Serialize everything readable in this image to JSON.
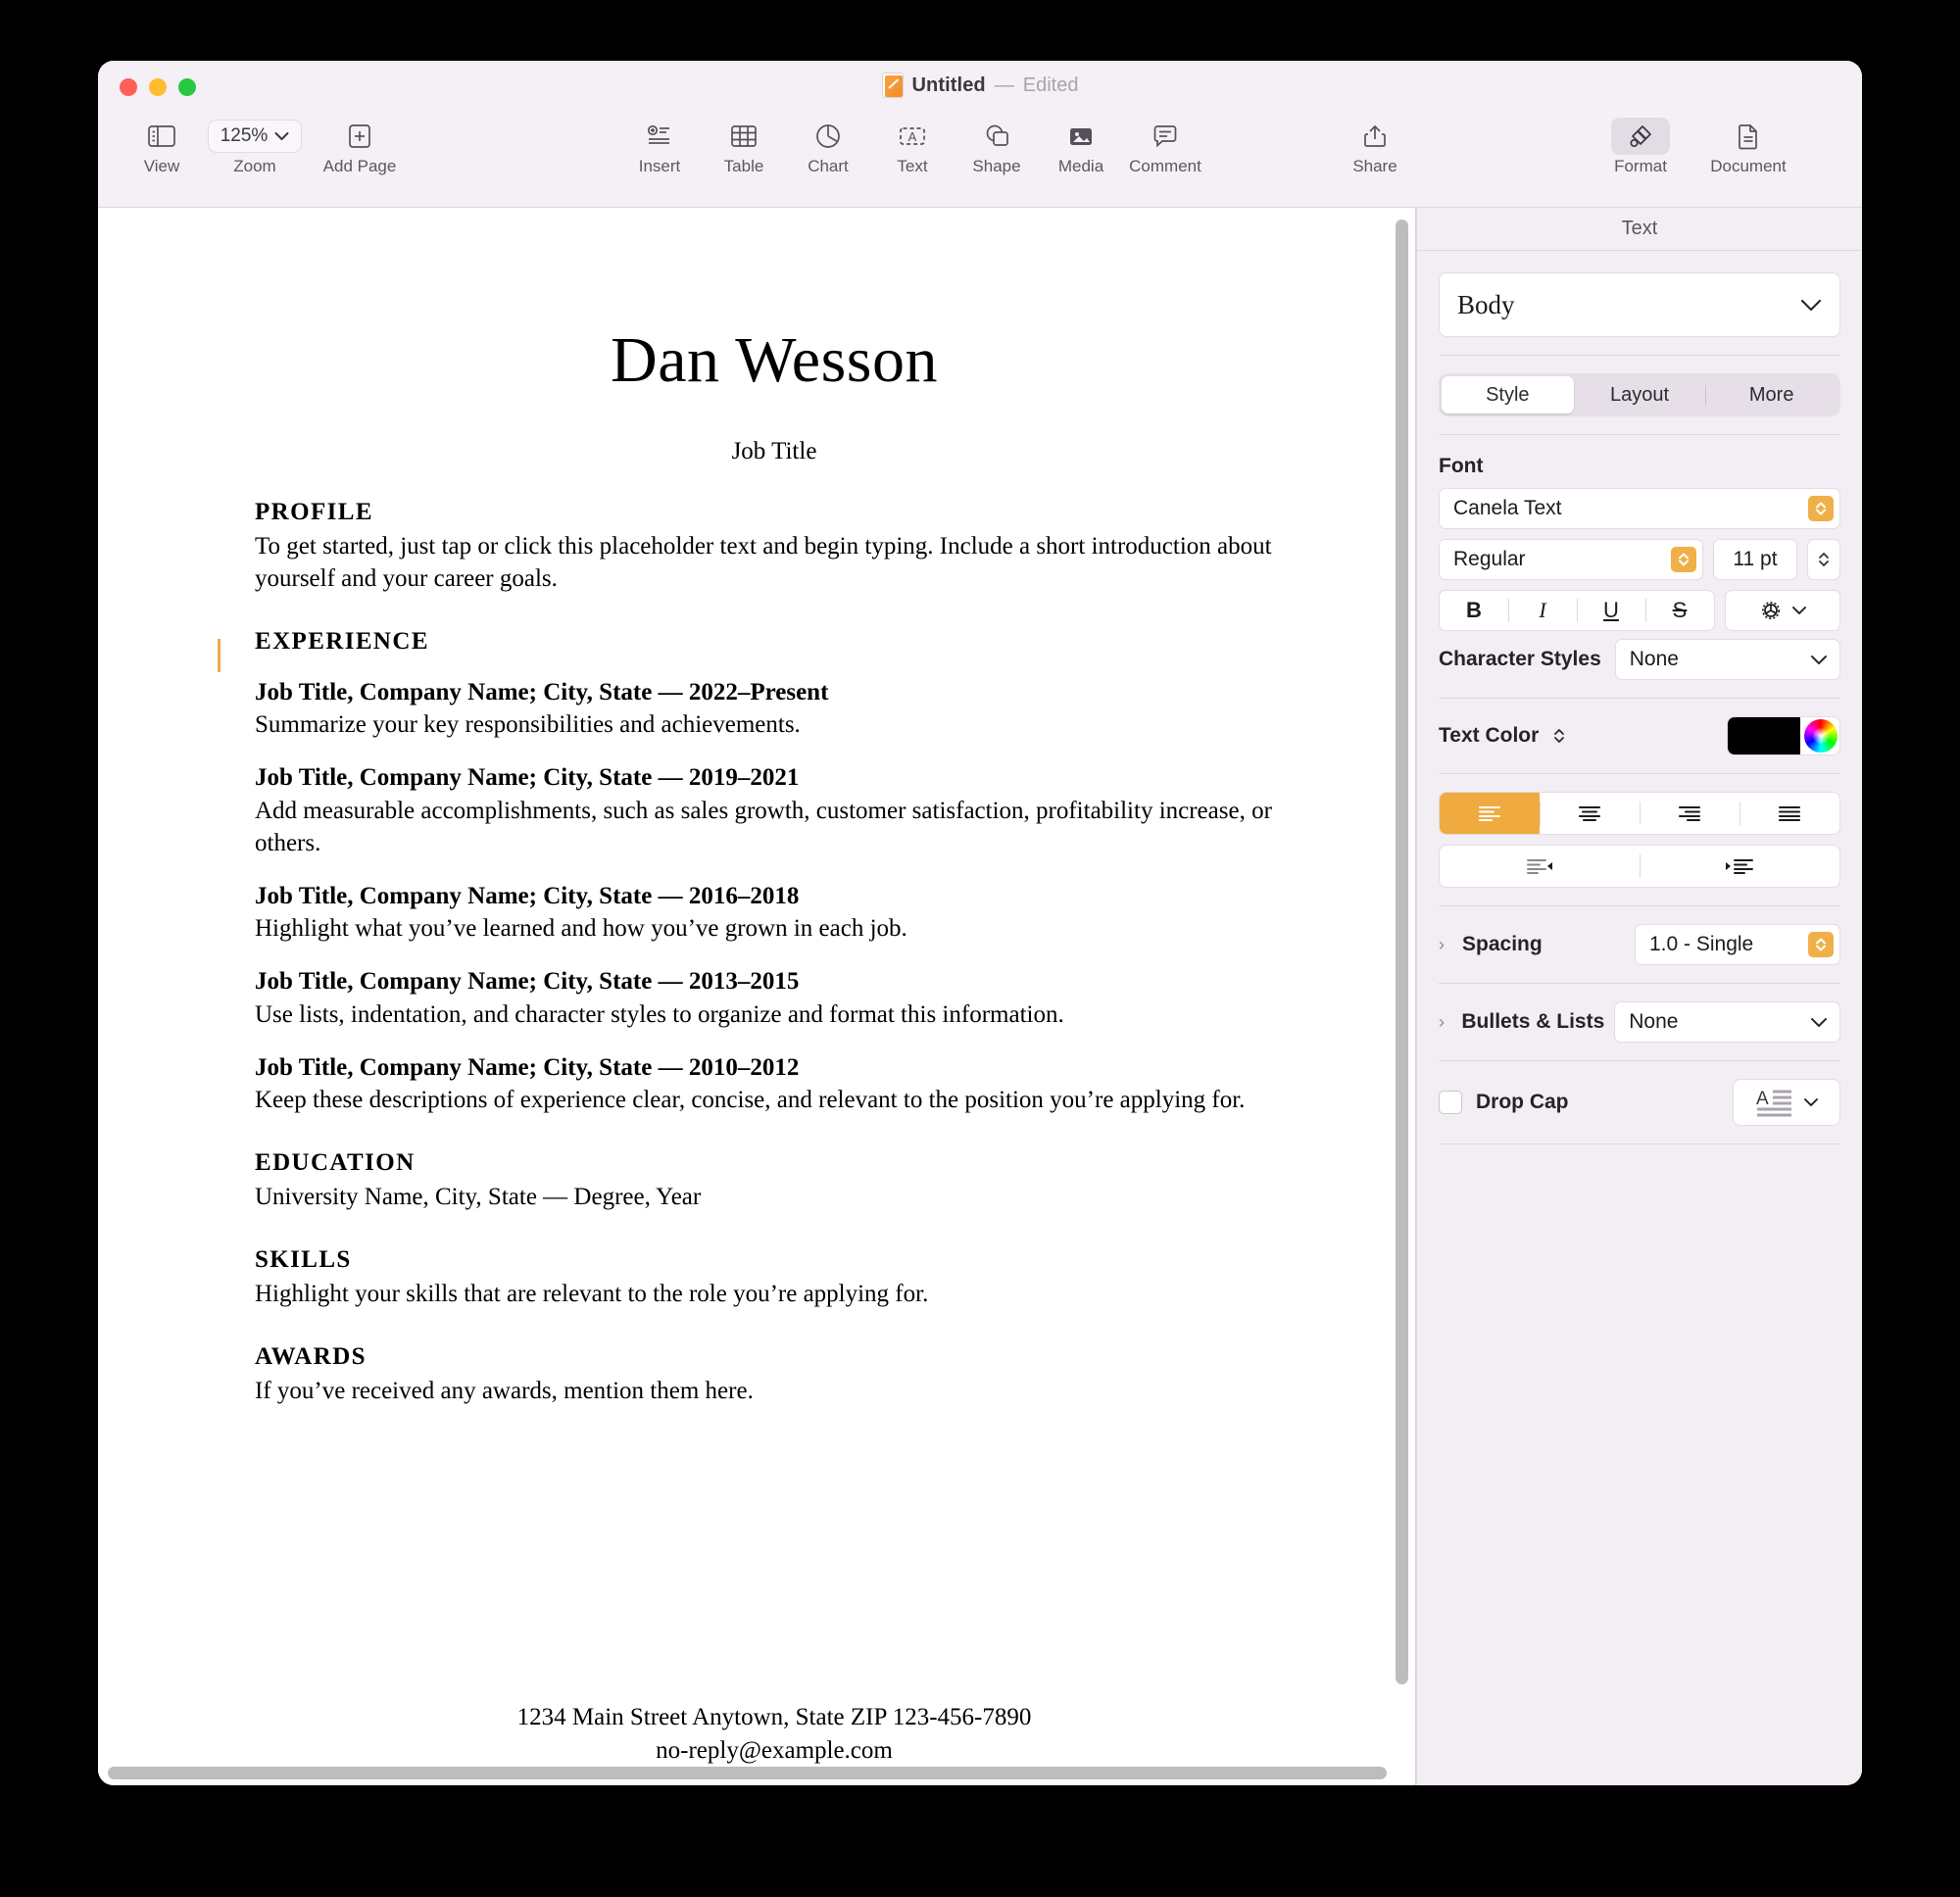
{
  "window": {
    "title": "Untitled",
    "separator": "—",
    "status": "Edited",
    "doc_icon": "pages-document-icon",
    "traffic_lights": [
      "close-button",
      "minimize-button",
      "maximize-button"
    ]
  },
  "toolbar": {
    "left": [
      {
        "label": "View",
        "icon": "sidebar-icon"
      },
      {
        "label": "Zoom",
        "icon": "zoom-chevron-icon",
        "value": "125%"
      },
      {
        "label": "Add Page",
        "icon": "add-page-icon"
      }
    ],
    "center": [
      {
        "label": "Insert",
        "icon": "insert-icon"
      },
      {
        "label": "Table",
        "icon": "table-icon"
      },
      {
        "label": "Chart",
        "icon": "chart-icon"
      },
      {
        "label": "Text",
        "icon": "text-box-icon"
      },
      {
        "label": "Shape",
        "icon": "shape-icon"
      },
      {
        "label": "Media",
        "icon": "media-icon"
      },
      {
        "label": "Comment",
        "icon": "comment-icon"
      }
    ],
    "right": [
      {
        "label": "Share",
        "icon": "share-icon",
        "active": false
      },
      {
        "label": "Format",
        "icon": "paintbrush-icon",
        "active": true
      },
      {
        "label": "Document",
        "icon": "document-icon",
        "active": false
      }
    ]
  },
  "document": {
    "name": "Dan Wesson",
    "subtitle": "Job Title",
    "sections": [
      {
        "heading": "PROFILE",
        "body": "To get started, just tap or click this placeholder text and begin typing. Include a short introduction about yourself and your career goals."
      },
      {
        "heading": "EXPERIENCE",
        "body": ""
      },
      {
        "heading": "EDUCATION",
        "body": "University Name, City, State — Degree, Year"
      },
      {
        "heading": "SKILLS",
        "body": "Highlight your skills that are relevant to the role you’re applying for."
      },
      {
        "heading": "AWARDS",
        "body": "If you’ve received any awards, mention them here."
      }
    ],
    "jobs": [
      {
        "title": "Job Title, Company Name; City, State — 2022–Present",
        "desc": "Summarize your key responsibilities and achievements."
      },
      {
        "title": "Job Title, Company Name; City, State — 2019–2021",
        "desc": "Add measurable accomplishments, such as sales growth, customer satisfaction, profitability increase, or others."
      },
      {
        "title": "Job Title, Company Name; City, State — 2016–2018",
        "desc": "Highlight what you’ve learned and how you’ve grown in each job."
      },
      {
        "title": "Job Title, Company Name; City, State — 2013–2015",
        "desc": "Use lists, indentation, and character styles to organize and format this information."
      },
      {
        "title": "Job Title, Company Name; City, State — 2010–2012",
        "desc": "Keep these descriptions of experience clear, concise, and relevant to the position you’re applying for."
      }
    ],
    "footer": {
      "line1": "1234 Main Street Anytown, State ZIP   123-456-7890",
      "line2": "no-reply@example.com"
    }
  },
  "inspector": {
    "panel_title": "Text",
    "paragraph_style": "Body",
    "tabs": [
      {
        "label": "Style",
        "active": true
      },
      {
        "label": "Layout",
        "active": false
      },
      {
        "label": "More",
        "active": false
      }
    ],
    "font": {
      "group_label": "Font",
      "family": "Canela Text",
      "weight": "Regular",
      "size": "11 pt",
      "bold": "B",
      "italic": "I",
      "underline": "U",
      "strikethrough": "S",
      "advanced_icon": "gear-icon"
    },
    "character_styles": {
      "label": "Character Styles",
      "value": "None"
    },
    "text_color": {
      "label": "Text Color",
      "swatch": "#000000"
    },
    "alignment": {
      "options": [
        "align-left",
        "align-center",
        "align-right",
        "align-justify"
      ],
      "selected": "align-left",
      "accent": "#efab3f"
    },
    "indent": {
      "options": [
        "decrease-indent",
        "increase-indent"
      ]
    },
    "spacing": {
      "label": "Spacing",
      "value": "1.0 - Single"
    },
    "bullets": {
      "label": "Bullets & Lists",
      "value": "None"
    },
    "drop_cap": {
      "label": "Drop Cap",
      "checked": false
    }
  }
}
